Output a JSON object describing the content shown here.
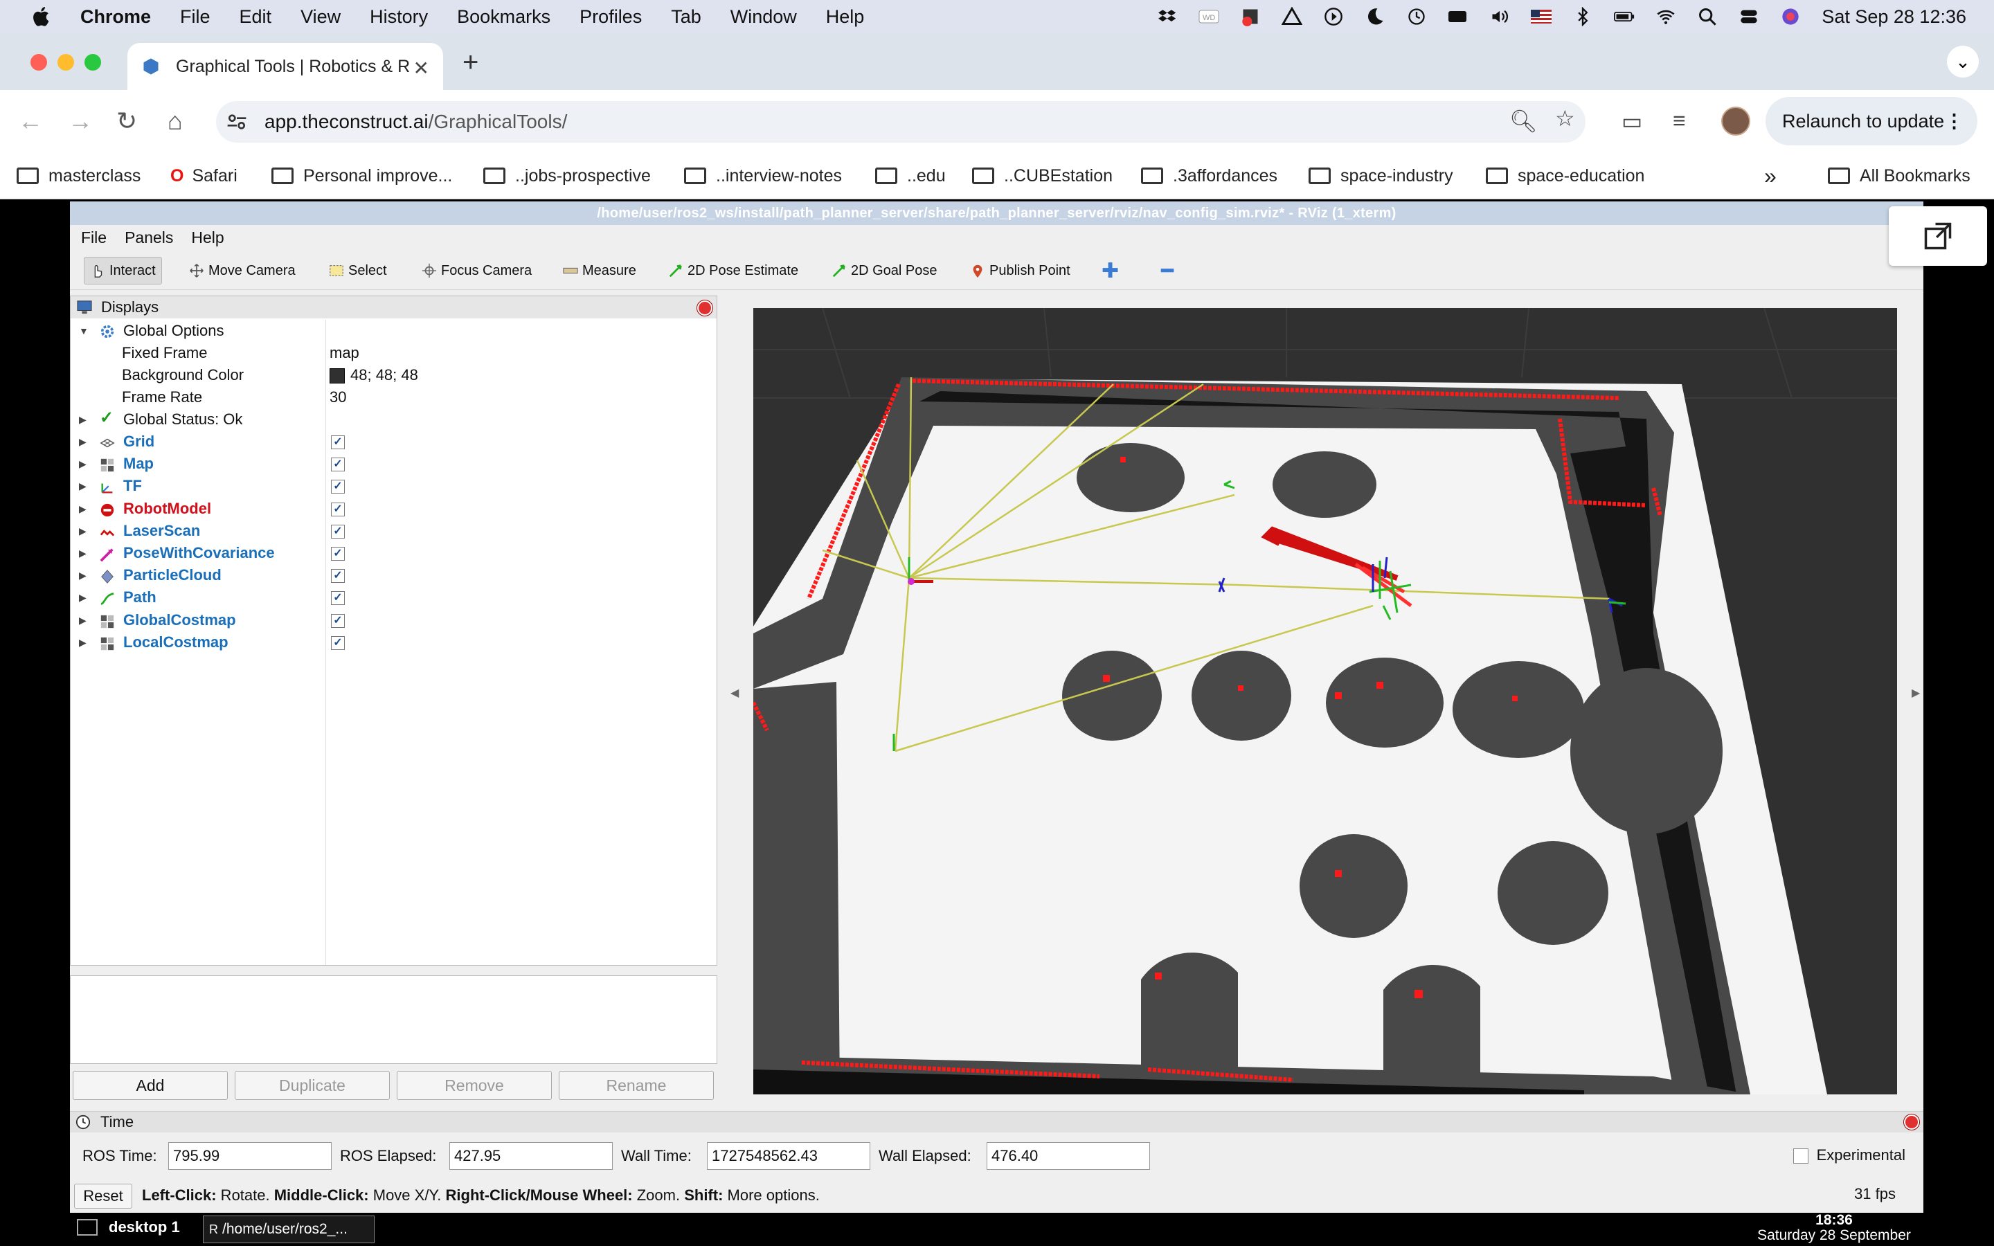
{
  "macos": {
    "menus": [
      "Chrome",
      "File",
      "Edit",
      "View",
      "History",
      "Bookmarks",
      "Profiles",
      "Tab",
      "Window",
      "Help"
    ],
    "datetime": "Sat Sep 28  12:36"
  },
  "chrome": {
    "tab_title": "Graphical Tools | Robotics & R",
    "url_host": "app.theconstruct.ai",
    "url_path": "/GraphicalTools/",
    "relaunch_label": "Relaunch to update",
    "bookmarks": [
      "masterclass",
      "Safari",
      "Personal improve...",
      "..jobs-prospective",
      "..interview-notes",
      "..edu",
      "..CUBEstation",
      ".3affordances",
      "space-industry",
      "space-education"
    ],
    "more_bookmarks": "»",
    "all_bookmarks": "All Bookmarks"
  },
  "rviz": {
    "window_title": "/home/user/ros2_ws/install/path_planner_server/share/path_planner_server/rviz/nav_config_sim.rviz* - RViz (1_xterm)",
    "menu": [
      "File",
      "Panels",
      "Help"
    ],
    "tools": [
      "Interact",
      "Move Camera",
      "Select",
      "Focus Camera",
      "Measure",
      "2D Pose Estimate",
      "2D Goal Pose",
      "Publish Point"
    ],
    "displays_title": "Displays",
    "global_options": {
      "label": "Global Options",
      "fixed_frame_label": "Fixed Frame",
      "fixed_frame": "map",
      "bg_label": "Background Color",
      "bg_value": "48; 48; 48",
      "frame_rate_label": "Frame Rate",
      "frame_rate": "30"
    },
    "global_status": "Global Status: Ok",
    "displays": [
      {
        "label": "Grid",
        "color": "blue",
        "checked": true
      },
      {
        "label": "Map",
        "color": "blue",
        "checked": true
      },
      {
        "label": "TF",
        "color": "blue",
        "checked": true
      },
      {
        "label": "RobotModel",
        "color": "red",
        "checked": true
      },
      {
        "label": "LaserScan",
        "color": "blue",
        "checked": true
      },
      {
        "label": "PoseWithCovariance",
        "color": "blue",
        "checked": true
      },
      {
        "label": "ParticleCloud",
        "color": "blue",
        "checked": true
      },
      {
        "label": "Path",
        "color": "blue",
        "checked": true
      },
      {
        "label": "GlobalCostmap",
        "color": "blue",
        "checked": true
      },
      {
        "label": "LocalCostmap",
        "color": "blue",
        "checked": true
      }
    ],
    "buttons": [
      "Add",
      "Duplicate",
      "Remove",
      "Rename"
    ],
    "time": {
      "title": "Time",
      "ros_time_label": "ROS Time:",
      "ros_time": "795.99",
      "ros_elapsed_label": "ROS Elapsed:",
      "ros_elapsed": "427.95",
      "wall_time_label": "Wall Time:",
      "wall_time": "1727548562.43",
      "wall_elapsed_label": "Wall Elapsed:",
      "wall_elapsed": "476.40",
      "experimental": "Experimental"
    },
    "reset": "Reset",
    "hint_parts": [
      "Left-Click:",
      " Rotate. ",
      "Middle-Click:",
      " Move X/Y. ",
      "Right-Click/Mouse Wheel:",
      " Zoom. ",
      "Shift:",
      " More options."
    ],
    "fps": "31 fps"
  },
  "taskbar": {
    "desktop": "desktop 1",
    "item": "/home/user/ros2_...",
    "time": "18:36",
    "date": "Saturday 28 September"
  },
  "colors": {
    "laser": "#ff1a1a",
    "costmap_dark": "#464646",
    "free": "#f2f2f2",
    "path": "#c8c850"
  }
}
